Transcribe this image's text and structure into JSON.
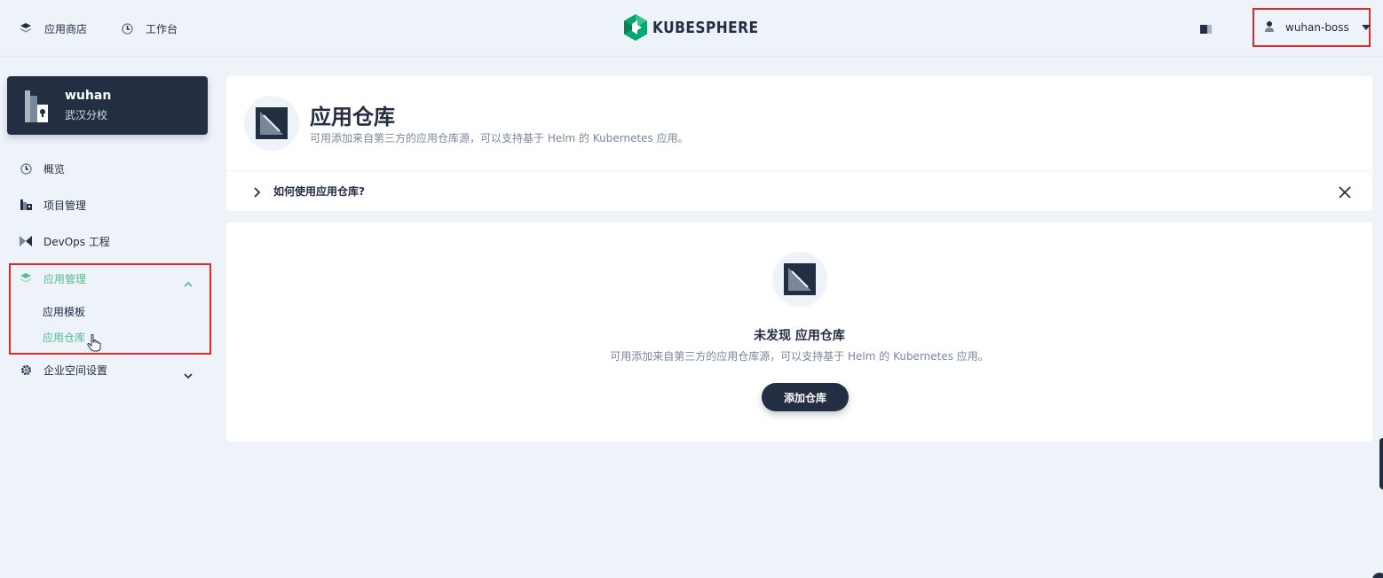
{
  "topbar": {
    "nav": [
      {
        "label": "应用商店",
        "icon": "appstore-icon"
      },
      {
        "label": "工作台",
        "icon": "dashboard-icon"
      }
    ],
    "logo_text": "KUBESPHERE",
    "user": {
      "name": "wuhan-boss"
    }
  },
  "workspace": {
    "name": "wuhan",
    "description": "武汉分校"
  },
  "sidebar": {
    "items": [
      {
        "label": "概览",
        "icon": "dashboard-icon"
      },
      {
        "label": "项目管理",
        "icon": "project-icon"
      },
      {
        "label": "DevOps 工程",
        "icon": "devops-icon"
      },
      {
        "label": "应用管理",
        "icon": "appstore-icon",
        "expanded": true,
        "active": true,
        "children": [
          {
            "label": "应用模板",
            "active": false
          },
          {
            "label": "应用仓库",
            "active": true
          }
        ]
      },
      {
        "label": "企业空间设置",
        "icon": "gear-icon",
        "expanded": false
      }
    ]
  },
  "page": {
    "title": "应用仓库",
    "description": "可用添加来自第三方的应用仓库源，可以支持基于 Helm 的 Kubernetes 应用。",
    "help_text": "如何使用应用仓库?"
  },
  "empty_state": {
    "title": "未发现 应用仓库",
    "description": "可用添加来自第三方的应用仓库源，可以支持基于 Helm 的 Kubernetes 应用。",
    "button_label": "添加仓库"
  },
  "colors": {
    "accent": "#55bc8a",
    "dark": "#242e42",
    "highlight": "#e0292c",
    "background": "#eef2f9"
  }
}
